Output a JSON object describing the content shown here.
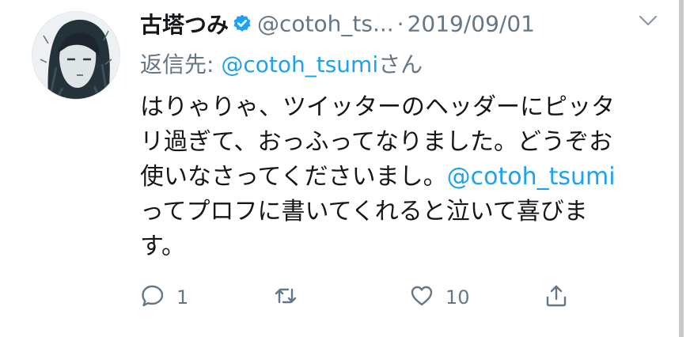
{
  "tweet": {
    "display_name": "古塔つみ",
    "handle": "@cotoh_ts...",
    "separator": "·",
    "date": "2019/09/01",
    "reply_prefix": "返信先: ",
    "reply_mention": "@cotoh_tsumi",
    "reply_suffix": "さん",
    "lines": [
      "はりゃりゃ、ツイッターのヘッダーにピッタ",
      "リ過ぎて、おっふってなりました。どうぞお",
      "使いなさってくださいまし。",
      "ってプロフに書いてくれると泣いて喜びま",
      "す。"
    ],
    "body_mention": "@cotoh_tsumi",
    "reply_count": "1",
    "retweet_count": "",
    "like_count": "10"
  },
  "icons": {
    "verified": "verified-badge-icon",
    "more": "more-icon",
    "reply": "reply-icon",
    "retweet": "retweet-icon",
    "like": "heart-icon",
    "share": "share-icon"
  },
  "colors": {
    "accent": "#1da1f2",
    "text": "#14171a",
    "muted": "#657786"
  }
}
